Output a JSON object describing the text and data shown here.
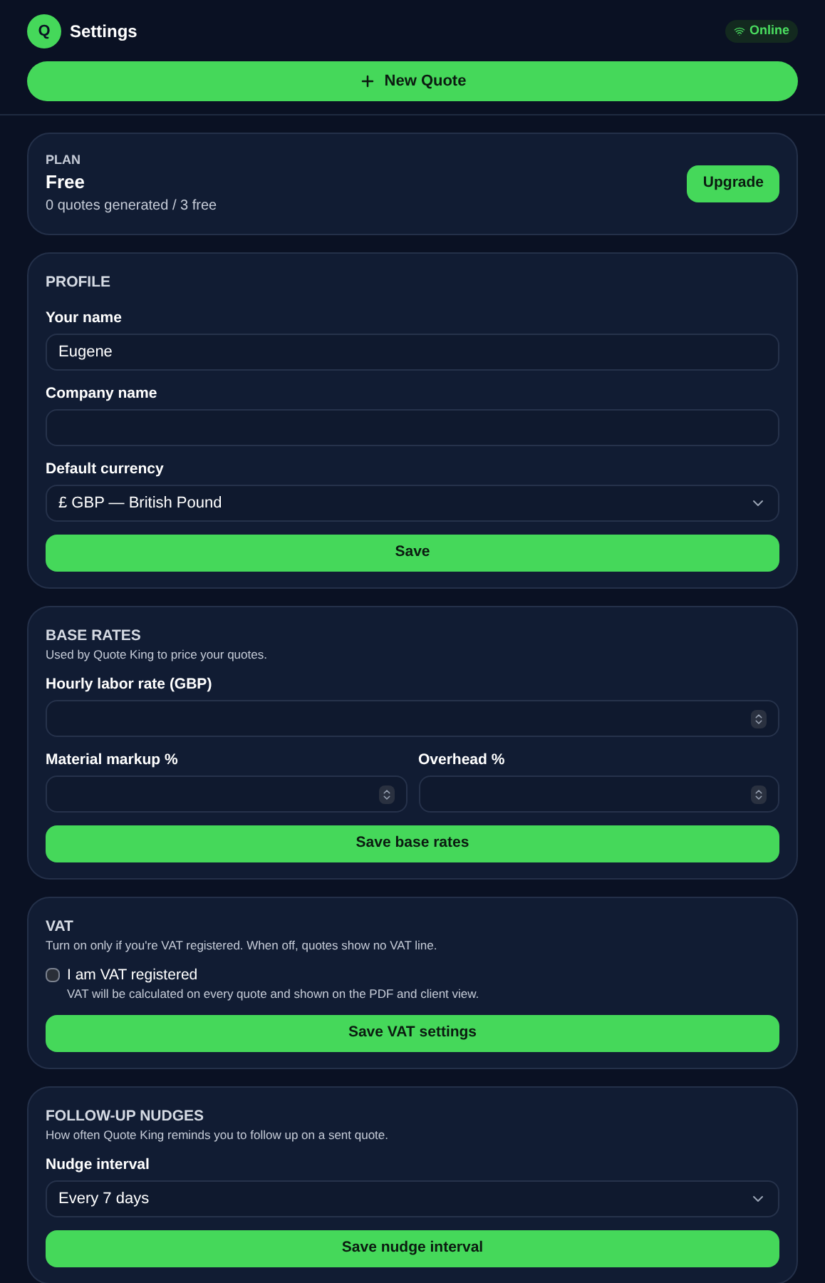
{
  "header": {
    "logo_letter": "Q",
    "title": "Settings",
    "status": {
      "label": "Online",
      "online": true
    }
  },
  "new_quote_button": {
    "label": "New Quote"
  },
  "plan": {
    "heading": "PLAN",
    "name": "Free",
    "usage": "0 quotes generated / 3 free",
    "button": "Upgrade"
  },
  "sections": [
    {
      "heading": "PROFILE",
      "rows": [
        [
          {
            "kind": "text",
            "label": "Your name",
            "value": "Eugene"
          }
        ],
        [
          {
            "kind": "text",
            "label": "Company name"
          }
        ],
        [
          {
            "kind": "select",
            "label": "Default currency",
            "value": "£ GBP — British Pound"
          }
        ]
      ],
      "button": "Save"
    },
    {
      "heading": "BASE RATES",
      "description": "Used by Quote King to price your quotes.",
      "rows": [
        [
          {
            "kind": "number",
            "label": "Hourly labor rate (GBP)"
          }
        ],
        [
          {
            "kind": "number",
            "label": "Material markup %"
          },
          {
            "kind": "number",
            "label": "Overhead %"
          }
        ]
      ],
      "button": "Save base rates"
    },
    {
      "heading": "VAT",
      "description": "Turn on only if you're VAT registered. When off, quotes show no VAT line.",
      "checkbox": {
        "label": "I am VAT registered",
        "hint": "VAT will be calculated on every quote and shown on the PDF and client view.",
        "checked": false
      },
      "button": "Save VAT settings"
    },
    {
      "heading": "FOLLOW-UP NUDGES",
      "description": "How often Quote King reminds you to follow up on a sent quote.",
      "rows": [
        [
          {
            "kind": "select",
            "label": "Nudge interval",
            "value": "Every 7 days"
          }
        ]
      ],
      "button": "Save nudge interval"
    }
  ]
}
